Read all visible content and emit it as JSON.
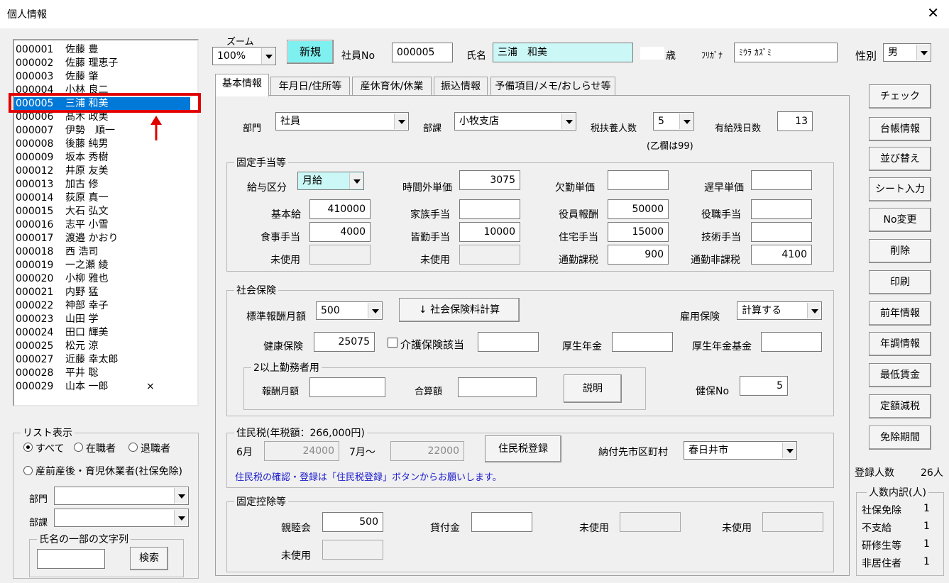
{
  "window": {
    "title": "個人情報"
  },
  "employees": [
    {
      "no": "000001",
      "name": "佐藤 豊",
      "mark": ""
    },
    {
      "no": "000002",
      "name": "佐藤 理恵子",
      "mark": ""
    },
    {
      "no": "000003",
      "name": "佐藤 肇",
      "mark": ""
    },
    {
      "no": "000004",
      "name": "小林 良二",
      "mark": ""
    },
    {
      "no": "000005",
      "name": "三浦 和美",
      "mark": ""
    },
    {
      "no": "000006",
      "name": "髙木 政美",
      "mark": ""
    },
    {
      "no": "000007",
      "name": "伊勢　順一",
      "mark": ""
    },
    {
      "no": "000008",
      "name": "後藤 純男",
      "mark": ""
    },
    {
      "no": "000009",
      "name": "坂本 秀樹",
      "mark": ""
    },
    {
      "no": "000012",
      "name": "井原 友美",
      "mark": ""
    },
    {
      "no": "000013",
      "name": "加古 修",
      "mark": ""
    },
    {
      "no": "000014",
      "name": "荻原 真一",
      "mark": ""
    },
    {
      "no": "000015",
      "name": "大石 弘文",
      "mark": ""
    },
    {
      "no": "000016",
      "name": "志平 小雪",
      "mark": ""
    },
    {
      "no": "000017",
      "name": "渡邉 かおり",
      "mark": ""
    },
    {
      "no": "000018",
      "name": "西 浩司",
      "mark": ""
    },
    {
      "no": "000019",
      "name": "一之瀬 綾",
      "mark": ""
    },
    {
      "no": "000020",
      "name": "小柳 雅也",
      "mark": ""
    },
    {
      "no": "000021",
      "name": "内野 猛",
      "mark": ""
    },
    {
      "no": "000022",
      "name": "神部 幸子",
      "mark": ""
    },
    {
      "no": "000023",
      "name": "山田 学",
      "mark": ""
    },
    {
      "no": "000024",
      "name": "田口 輝美",
      "mark": ""
    },
    {
      "no": "000025",
      "name": "松元 涼",
      "mark": ""
    },
    {
      "no": "000027",
      "name": "近藤 幸太郎",
      "mark": ""
    },
    {
      "no": "000028",
      "name": "平井 聡",
      "mark": ""
    },
    {
      "no": "000029",
      "name": "山本 一郎",
      "mark": "×"
    }
  ],
  "selected_index": 4,
  "listfilter": {
    "title": "リスト表示",
    "opt_all": "すべて",
    "opt_active": "在職者",
    "opt_retired": "退職者",
    "opt_leave": "産前産後・育児休業者(社保免除)",
    "dept_label": "部門",
    "section_label": "部課",
    "name_group": "氏名の一部の文字列",
    "search_button": "検索",
    "dept_value": "",
    "section_value": "",
    "name_value": ""
  },
  "header": {
    "zoom_label": "ズーム",
    "zoom_value": "100%",
    "new_button": "新規",
    "empno_label": "社員No",
    "empno_value": "000005",
    "name_label": "氏名",
    "name_value": "三浦　和美",
    "age_value": "",
    "age_unit": "歳",
    "kana_label": "ﾌﾘｶﾞﾅ",
    "kana_value": "ﾐｳﾗ ｶｽﾞﾐ",
    "sex_label": "性別",
    "sex_value": "男"
  },
  "tabs": [
    "基本情報",
    "年月日/住所等",
    "産休育休/休業",
    "振込情報",
    "予備項目/メモ/おしらせ等"
  ],
  "basic": {
    "dept_label": "部門",
    "dept_value": "社員",
    "section_label": "部課",
    "section_value": "小牧支店",
    "dependents_label": "税扶養人数",
    "dependents_value": "5",
    "dependents_note": "(乙欄は99)",
    "paid_leave_label": "有給残日数",
    "paid_leave_value": "13"
  },
  "allowances": {
    "title": "固定手当等",
    "pay_type_label": "給与区分",
    "pay_type_value": "月給",
    "overtime_label": "時間外単価",
    "overtime_value": "3075",
    "absence_label": "欠勤単価",
    "absence_value": "",
    "late_label": "遅早単価",
    "late_value": "",
    "base_label": "基本給",
    "base_value": "410000",
    "family_label": "家族手当",
    "family_value": "",
    "exec_label": "役員報酬",
    "exec_value": "50000",
    "position_label": "役職手当",
    "position_value": "",
    "meal_label": "食事手当",
    "meal_value": "4000",
    "attend_label": "皆勤手当",
    "attend_value": "10000",
    "housing_label": "住宅手当",
    "housing_value": "15000",
    "skill_label": "技術手当",
    "skill_value": "",
    "unused1_label": "未使用",
    "unused1_value": "",
    "unused2_label": "未使用",
    "unused2_value": "",
    "commute_tax_label": "通勤課税",
    "commute_tax_value": "900",
    "commute_free_label": "通勤非課税",
    "commute_free_value": "4100"
  },
  "social": {
    "title": "社会保険",
    "std_label": "標準報酬月額",
    "std_value": "500",
    "calc_button": "↓ 社会保険料計算",
    "emp_ins_label": "雇用保険",
    "emp_ins_value": "計算する",
    "health_label": "健康保険",
    "health_value": "25075",
    "care_label": "介護保険該当",
    "care_value": "",
    "pension_label": "厚生年金",
    "pension_value": "",
    "fund_label": "厚生年金基金",
    "fund_value": "",
    "multi_title": "2以上勤務者用",
    "multi_pay_label": "報酬月額",
    "multi_pay_value": "",
    "multi_sum_label": "合算額",
    "multi_sum_value": "",
    "explain_button": "説明",
    "health_no_label": "健保No",
    "health_no_value": "5"
  },
  "resident": {
    "title": "住民税(年税額：266,000円)",
    "june_label": "6月",
    "june_value": "24000",
    "july_label": "7月～",
    "july_value": "22000",
    "register_button": "住民税登録",
    "city_label": "納付先市区町村",
    "city_value": "春日井市",
    "note": "住民税の確認・登録は「住民税登録」ボタンからお願いします。"
  },
  "deductions": {
    "title": "固定控除等",
    "friend_label": "親睦会",
    "friend_value": "500",
    "loan_label": "貸付金",
    "loan_value": "",
    "unused1_label": "未使用",
    "unused1_value": "",
    "unused2_label": "未使用",
    "unused2_value": "",
    "unused3_label": "未使用",
    "unused3_value": ""
  },
  "side_buttons": [
    "チェック",
    "台帳情報",
    "並び替え",
    "シート入力",
    "No変更",
    "削除",
    "印刷",
    "前年情報",
    "年調情報",
    "最低賃金",
    "定額減税",
    "免除期間"
  ],
  "summary": {
    "count_label": "登録人数",
    "count_value": "26人",
    "breakdown_title": "人数内訳(人)",
    "rows": [
      {
        "label": "社保免除",
        "value": "1"
      },
      {
        "label": "不支給",
        "value": "1"
      },
      {
        "label": "研修生等",
        "value": "1"
      },
      {
        "label": "非居住者",
        "value": "1"
      }
    ]
  },
  "colors": {
    "selection": "#0078d7",
    "highlight_red": "#e00000",
    "new_button": "#7ff0f0",
    "name_field": "#ccf7f7",
    "pay_type_field": "#ccf7f7",
    "note_text": "#1a1acc"
  }
}
